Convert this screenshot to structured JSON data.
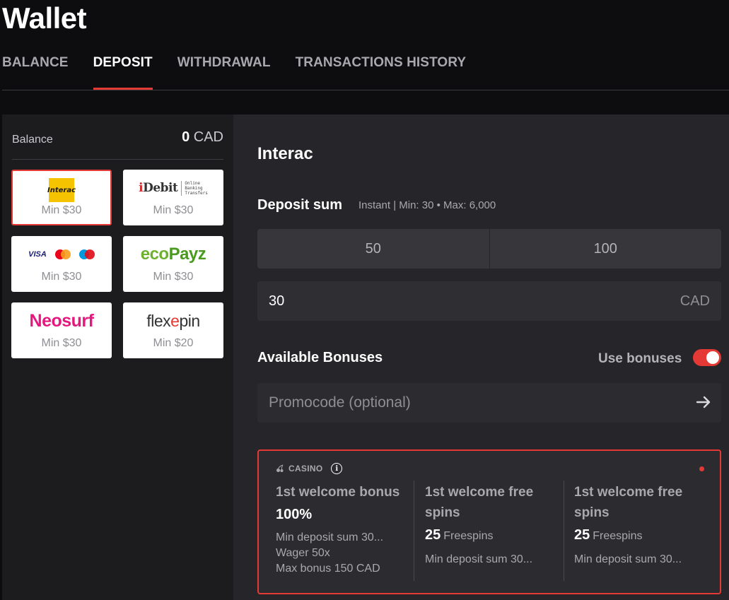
{
  "page": {
    "title": "Wallet"
  },
  "tabs": [
    {
      "label": "BALANCE",
      "active": false
    },
    {
      "label": "DEPOSIT",
      "active": true
    },
    {
      "label": "WITHDRAWAL",
      "active": false
    },
    {
      "label": "TRANSACTIONS HISTORY",
      "active": false
    }
  ],
  "balance": {
    "label": "Balance",
    "amount": "0",
    "currency": "CAD"
  },
  "methods": [
    {
      "name": "Interac",
      "logo_text": "Interac",
      "min": "Min $30",
      "selected": true
    },
    {
      "name": "iDebit",
      "logo_text": "iDebit",
      "logo_sub": "Online Banking Transfers",
      "min": "Min $30",
      "selected": false
    },
    {
      "name": "Cards",
      "logo_text": "VISA",
      "min": "Min $30",
      "selected": false
    },
    {
      "name": "ecoPayz",
      "logo_text_a": "eco",
      "logo_text_b": "Payz",
      "min": "Min $30",
      "selected": false
    },
    {
      "name": "Neosurf",
      "logo_text": "Neosurf",
      "min": "Min $30",
      "selected": false
    },
    {
      "name": "flexepin",
      "logo_text_a": "flex",
      "logo_text_b": "e",
      "logo_text_c": "pin",
      "min": "Min $20",
      "selected": false
    }
  ],
  "deposit": {
    "method_title": "Interac",
    "sum_label": "Deposit sum",
    "sum_info": "Instant | Min: 30 • Max: 6,000",
    "quick_amounts": [
      "50",
      "100"
    ],
    "amount_value": "30",
    "currency": "CAD"
  },
  "bonuses": {
    "label": "Available Bonuses",
    "use_label": "Use bonuses",
    "use_enabled": true,
    "promo_placeholder": "Promocode (optional)",
    "category": "CASINO",
    "items": [
      {
        "title": "1st welcome bonus",
        "value": "100%",
        "lines": [
          "Min deposit sum 30...",
          "Wager 50x",
          "Max bonus 150 CAD"
        ]
      },
      {
        "title": "1st welcome free spins",
        "value": "25",
        "unit": "Freespins",
        "lines": [
          "Min deposit sum 30..."
        ]
      },
      {
        "title": "1st welcome free spins",
        "value": "25",
        "unit": "Freespins",
        "lines": [
          "Min deposit sum 30..."
        ]
      }
    ]
  },
  "colors": {
    "accent": "#e53935",
    "background": "#0d0d0f",
    "panel": "#26262a",
    "sidebar": "#1c1c1f"
  }
}
